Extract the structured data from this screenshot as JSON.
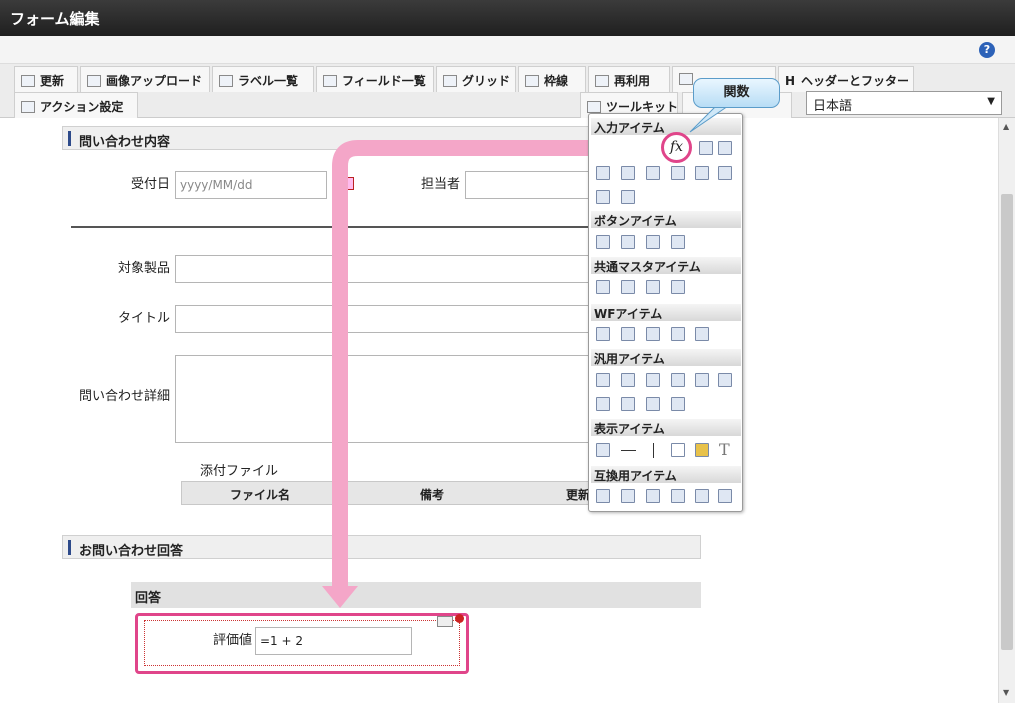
{
  "window": {
    "title": "フォーム編集"
  },
  "help": {
    "label": "?"
  },
  "toolbar": {
    "row1": [
      "更新",
      "画像アップロード",
      "ラベル一覧",
      "フィールド一覧",
      "グリッド",
      "枠線",
      "再利用"
    ],
    "header_footer": "ヘッダーとフッター",
    "header_icon_letter": "H",
    "action": "アクション設定",
    "toolkit": "ツールキット",
    "language": "日本語"
  },
  "form": {
    "section1": "問い合わせ内容",
    "received_date_label": "受付日",
    "received_date_placeholder": "yyyy/MM/dd",
    "assignee_label": "担当者",
    "product_label": "対象製品",
    "title_label": "タイトル",
    "detail_label": "問い合わせ詳細",
    "attachment_label": "添付ファイル",
    "grid_columns": [
      "ファイル名",
      "備考",
      "更新"
    ],
    "section2": "お問い合わせ回答",
    "subsection": "回答",
    "rating_label": "評価値",
    "rating_value": "=1 + 2"
  },
  "palette": {
    "categories": [
      "入力アイテム",
      "ボタンアイテム",
      "共通マスタアイテム",
      "WFアイテム",
      "汎用アイテム",
      "表示アイテム",
      "互換用アイテム"
    ],
    "function_symbol": "fx"
  },
  "callout": {
    "text": "関数"
  },
  "colors": {
    "highlight": "#e0458a",
    "arrow": "#f4a6c8",
    "titlebar": "#2a2a2a"
  }
}
